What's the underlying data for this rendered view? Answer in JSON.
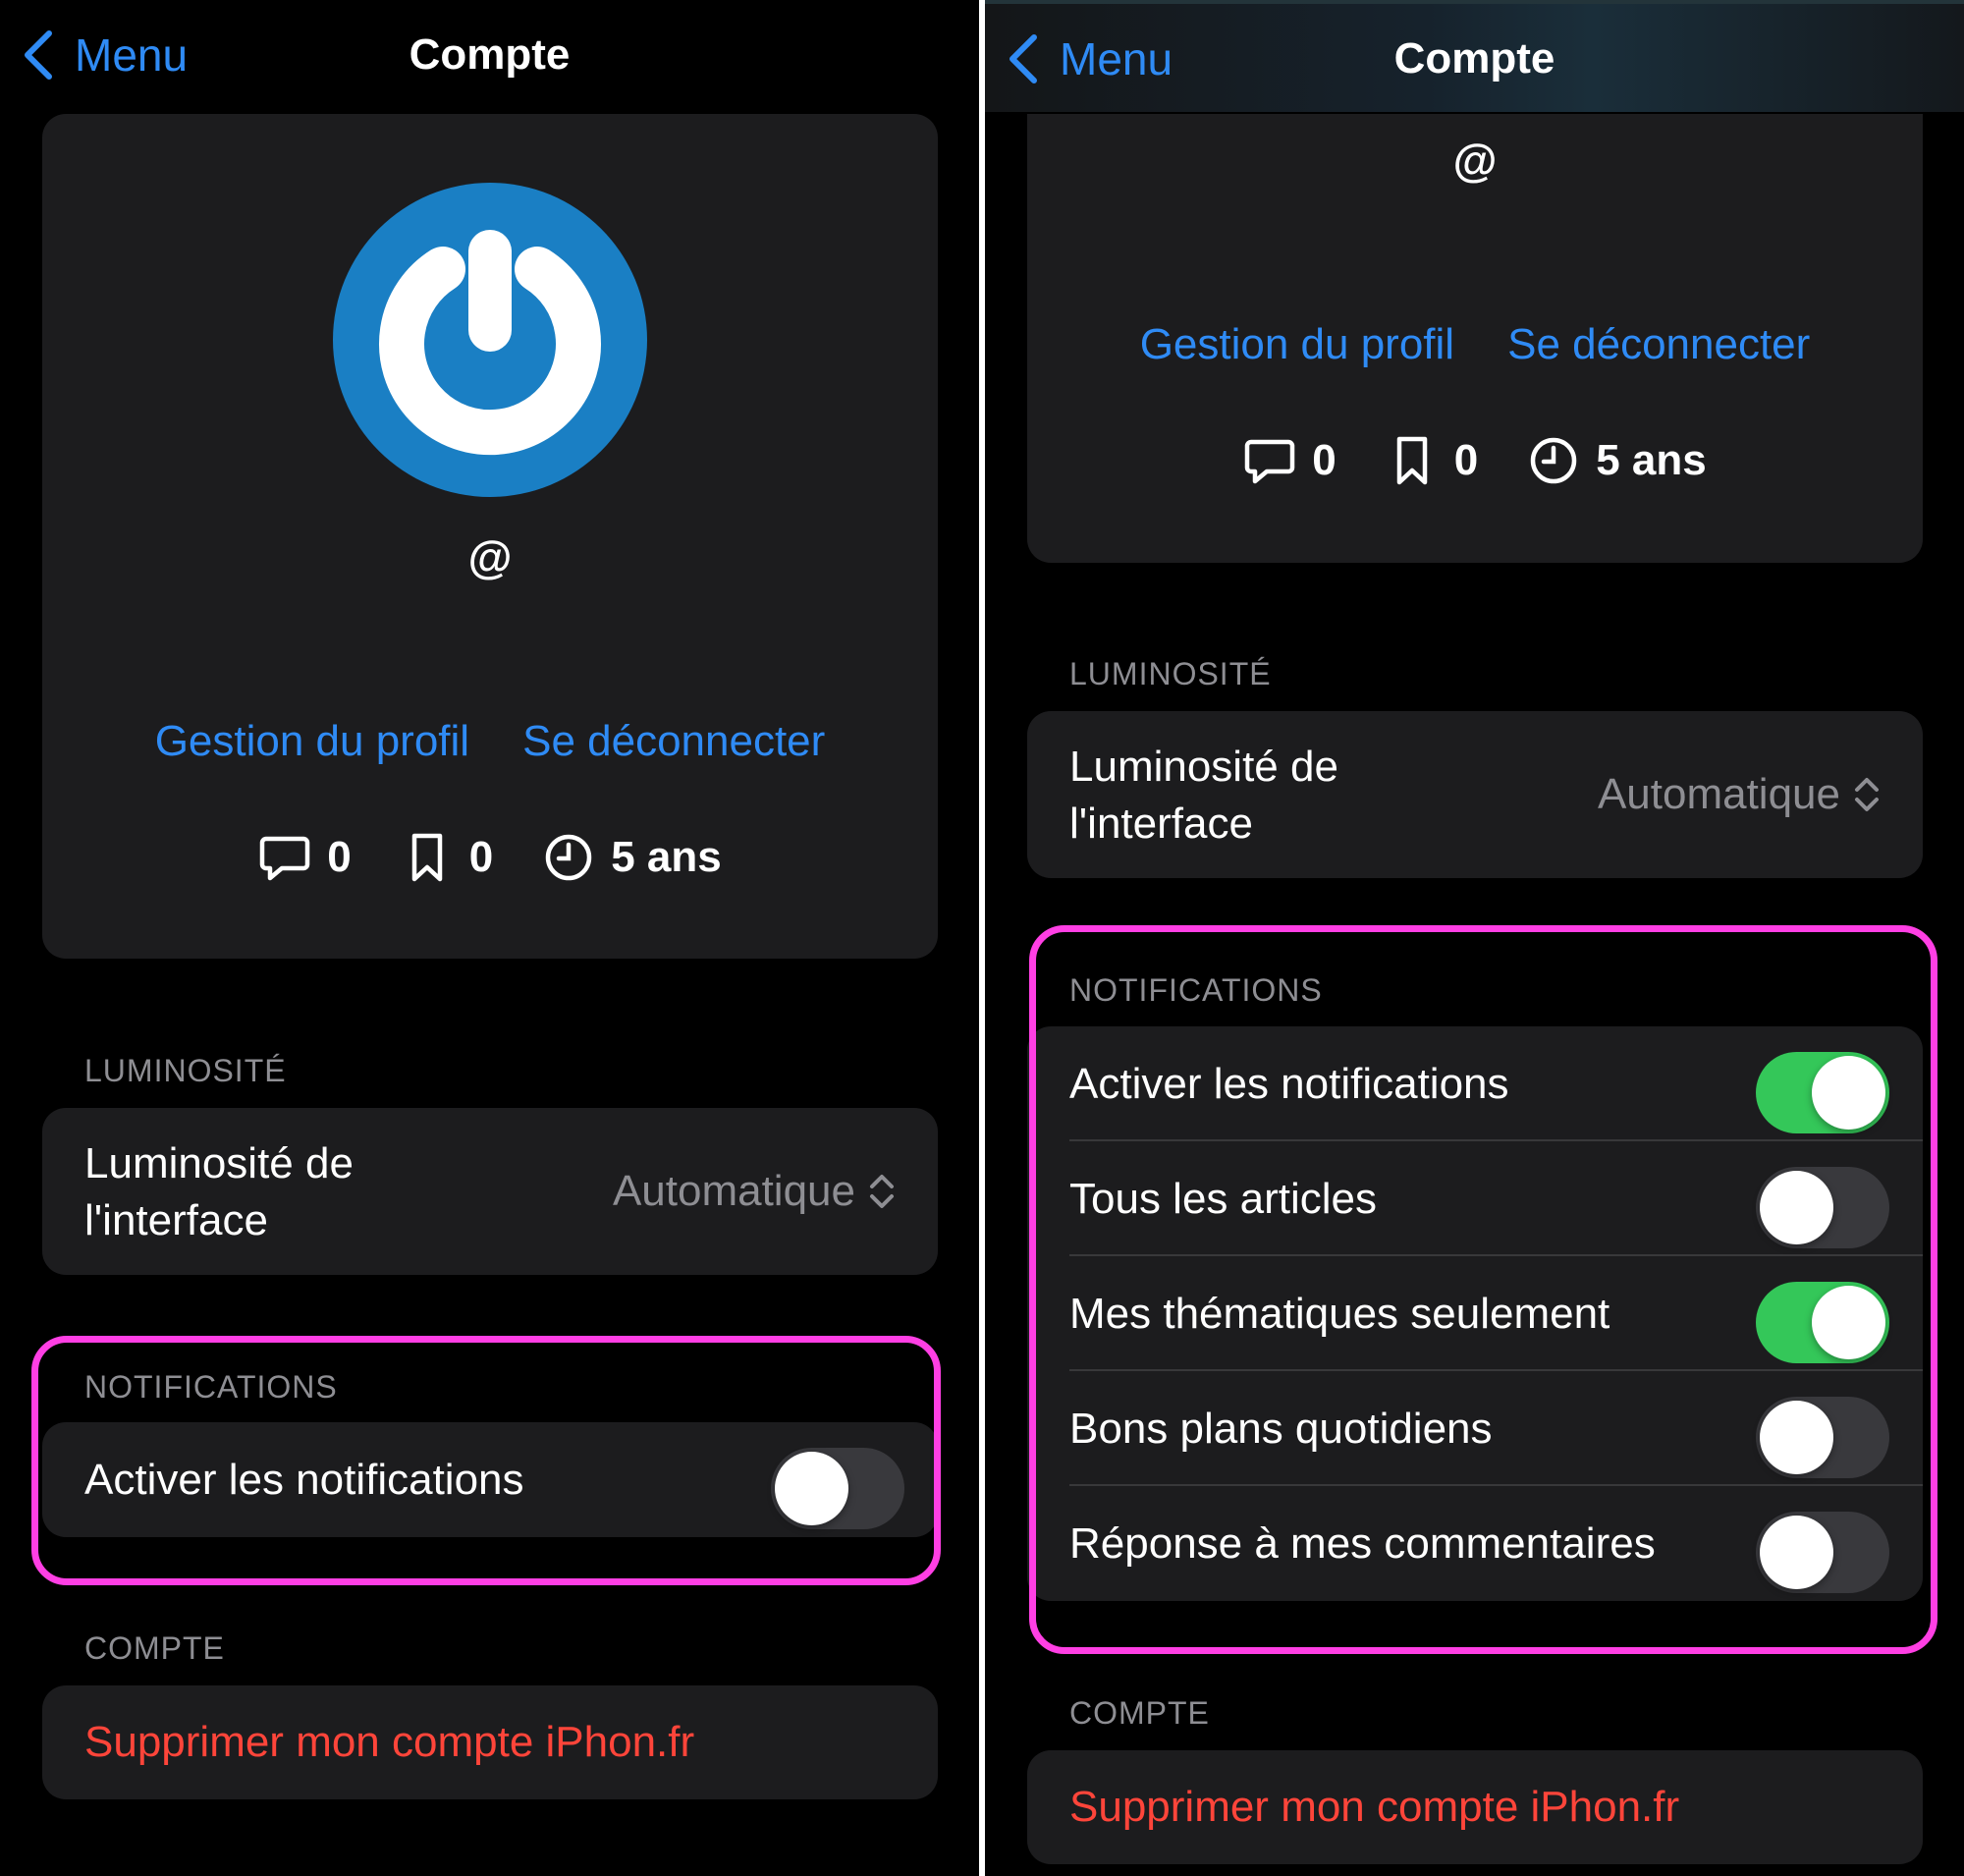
{
  "nav": {
    "back_label": "Menu",
    "title": "Compte"
  },
  "profile": {
    "handle": "@",
    "manage_link": "Gestion du profil",
    "logout_link": "Se déconnecter",
    "comments_count": "0",
    "bookmarks_count": "0",
    "seniority": "5 ans"
  },
  "luminosity": {
    "section_label": "LUMINOSITÉ",
    "row_title_line1": "Luminosité de",
    "row_title_line2": "l'interface",
    "value": "Automatique"
  },
  "notifications": {
    "section_label": "NOTIFICATIONS",
    "left_items": [
      {
        "label": "Activer les notifications",
        "enabled": false
      }
    ],
    "right_items": [
      {
        "label": "Activer les notifications",
        "enabled": true
      },
      {
        "label": "Tous les articles",
        "enabled": false
      },
      {
        "label": "Mes thématiques seulement",
        "enabled": true
      },
      {
        "label": "Bons plans quotidiens",
        "enabled": false
      },
      {
        "label": "Réponse à mes commentaires",
        "enabled": false
      }
    ]
  },
  "account": {
    "section_label": "COMPTE",
    "delete_label": "Supprimer mon compte iPhon.fr"
  },
  "colors": {
    "background": "#000000",
    "card": "#1c1c1e",
    "link_blue": "#2f8bf5",
    "toggle_on": "#34c759",
    "toggle_off": "#39393d",
    "danger_red": "#ff453a",
    "highlight_magenta": "#ff3fe4",
    "logo_blue": "#1a7fc4"
  },
  "icons": {
    "back": "chevron-left-icon",
    "logo": "power-logo-icon",
    "comments": "speech-bubble-icon",
    "bookmarks": "bookmark-icon",
    "seniority": "clock-icon",
    "select": "up-down-chevron-icon"
  }
}
